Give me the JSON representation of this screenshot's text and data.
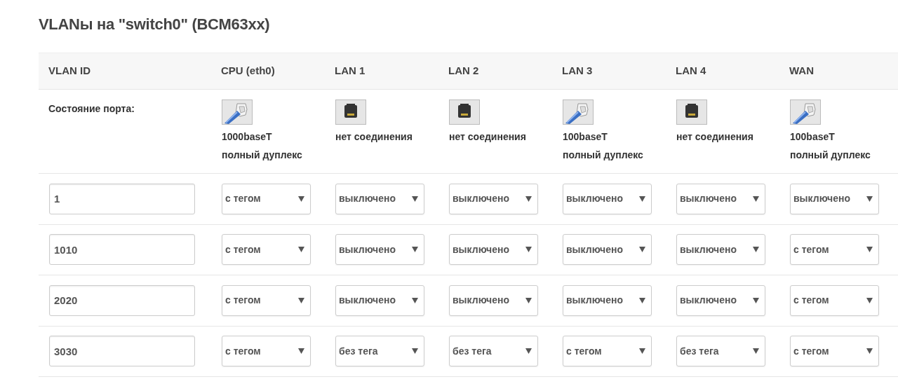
{
  "title": "VLANы на \"switch0\" (BCM63xx)",
  "columns": [
    "VLAN ID",
    "CPU (eth0)",
    "LAN 1",
    "LAN 2",
    "LAN 3",
    "LAN 4",
    "WAN"
  ],
  "port_status": {
    "label": "Состояние порта:",
    "ports": [
      {
        "connected": true,
        "lines": [
          "1000baseT",
          "полный дуплекс"
        ]
      },
      {
        "connected": false,
        "lines": [
          "нет соединения"
        ]
      },
      {
        "connected": false,
        "lines": [
          "нет соединения"
        ]
      },
      {
        "connected": true,
        "lines": [
          "100baseT",
          "полный дуплекс"
        ]
      },
      {
        "connected": false,
        "lines": [
          "нет соединения"
        ]
      },
      {
        "connected": true,
        "lines": [
          "100baseT",
          "полный дуплекс"
        ]
      }
    ]
  },
  "rows": [
    {
      "vlan_id": "1",
      "ports": [
        "с тегом",
        "выключено",
        "выключено",
        "выключено",
        "выключено",
        "выключено"
      ]
    },
    {
      "vlan_id": "1010",
      "ports": [
        "с тегом",
        "выключено",
        "выключено",
        "выключено",
        "выключено",
        "с тегом"
      ]
    },
    {
      "vlan_id": "2020",
      "ports": [
        "с тегом",
        "выключено",
        "выключено",
        "выключено",
        "выключено",
        "с тегом"
      ]
    },
    {
      "vlan_id": "3030",
      "ports": [
        "с тегом",
        "без тега",
        "без тега",
        "с тегом",
        "без тега",
        "с тегом"
      ]
    }
  ]
}
